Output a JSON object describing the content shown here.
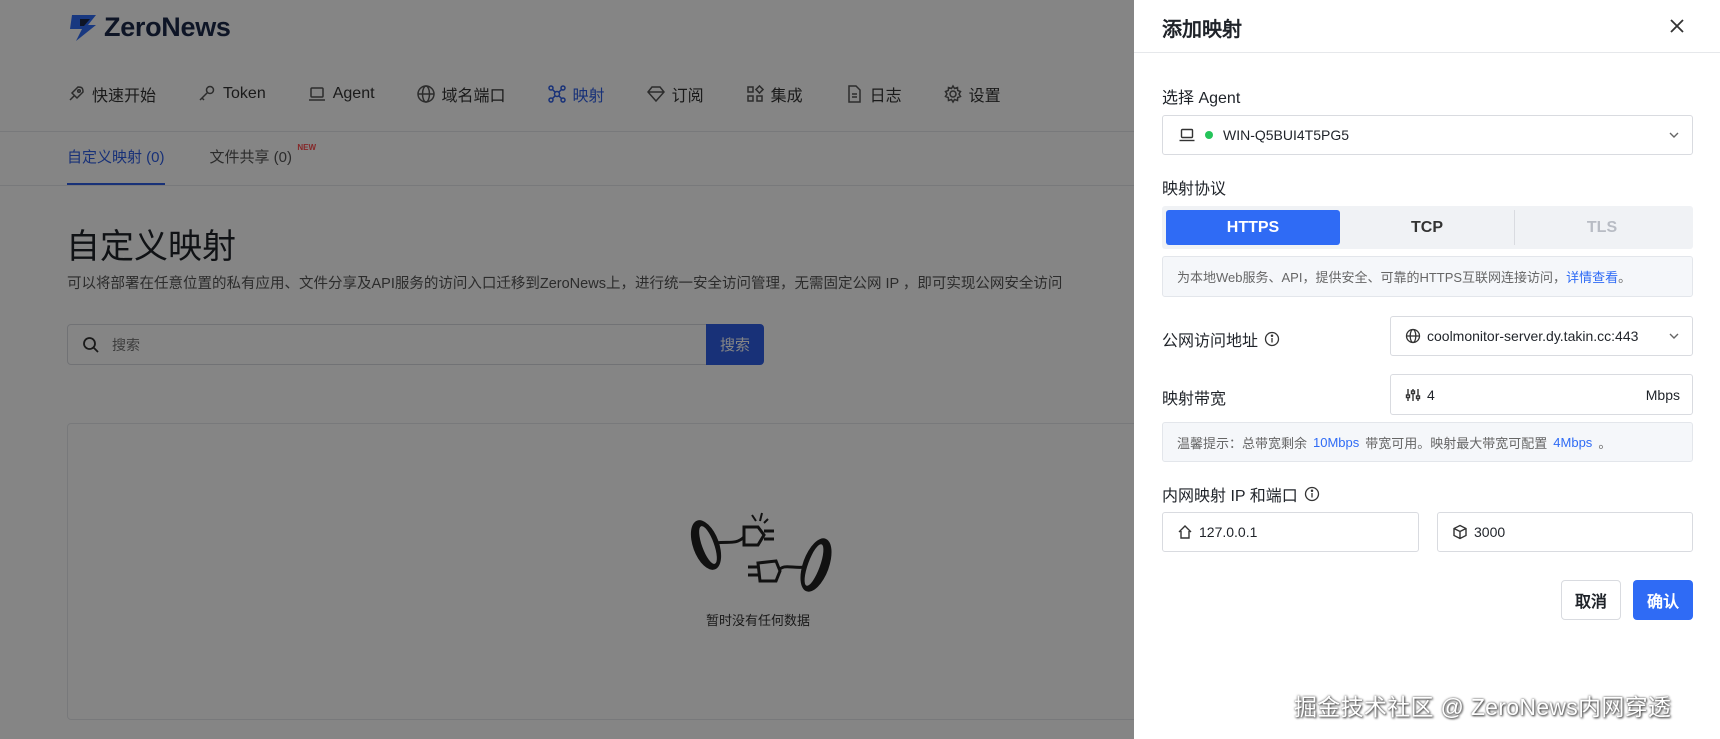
{
  "app": {
    "brand": "ZeroNews"
  },
  "nav": {
    "items": [
      {
        "label": "快速开始",
        "icon": "rocket-icon",
        "active": false
      },
      {
        "label": "Token",
        "icon": "key-icon",
        "active": false
      },
      {
        "label": "Agent",
        "icon": "laptop-icon",
        "active": false
      },
      {
        "label": "域名端口",
        "icon": "globe-icon",
        "active": false
      },
      {
        "label": "映射",
        "icon": "mapping-icon",
        "active": true
      },
      {
        "label": "订阅",
        "icon": "diamond-icon",
        "active": false
      },
      {
        "label": "集成",
        "icon": "grid-icon",
        "active": false
      },
      {
        "label": "日志",
        "icon": "document-icon",
        "active": false
      },
      {
        "label": "设置",
        "icon": "gear-icon",
        "active": false
      }
    ]
  },
  "subtabs": {
    "custom": "自定义映射 (0)",
    "share": "文件共享 (0)",
    "new_badge": "NEW"
  },
  "page": {
    "title": "自定义映射",
    "description": "可以将部署在任意位置的私有应用、文件分享及API服务的访问入口迁移到ZeroNews上，进行统一安全访问管理，无需固定公网 IP ，即可实现公网安全访问",
    "search_placeholder": "搜索",
    "search_button": "搜索",
    "empty_text": "暂时没有任何数据"
  },
  "drawer": {
    "title": "添加映射",
    "agent_label": "选择 Agent",
    "agent_value": "WIN-Q5BUI4T5PG5",
    "protocol_label": "映射协议",
    "protocols": [
      "HTTPS",
      "TCP",
      "TLS"
    ],
    "protocol_active": "HTTPS",
    "protocol_hint_text": "为本地Web服务、API，提供安全、可靠的HTTPS互联网连接访问，",
    "protocol_hint_link": "详情查看",
    "protocol_hint_end": "。",
    "public_label": "公网访问地址",
    "public_value": "coolmonitor-server.dy.takin.cc:443",
    "bandwidth_label": "映射带宽",
    "bandwidth_value": "4",
    "bandwidth_unit": "Mbps",
    "bw_hint_prefix": "温馨提示：总带宽剩余",
    "bw_hint_total": "10Mbps",
    "bw_hint_mid": "带宽可用。映射最大带宽可配置",
    "bw_hint_max": "4Mbps",
    "bw_hint_end": "。",
    "inner_label": "内网映射 IP 和端口",
    "inner_ip": "127.0.0.1",
    "inner_port": "3000",
    "cancel": "取消",
    "confirm": "确认"
  },
  "watermark": "掘金技术社区 @ ZeroNews内网穿透",
  "colors": {
    "primary": "#2f6bf5",
    "online": "#25c45a",
    "overlay": "rgba(0,0,0,0.48)"
  }
}
